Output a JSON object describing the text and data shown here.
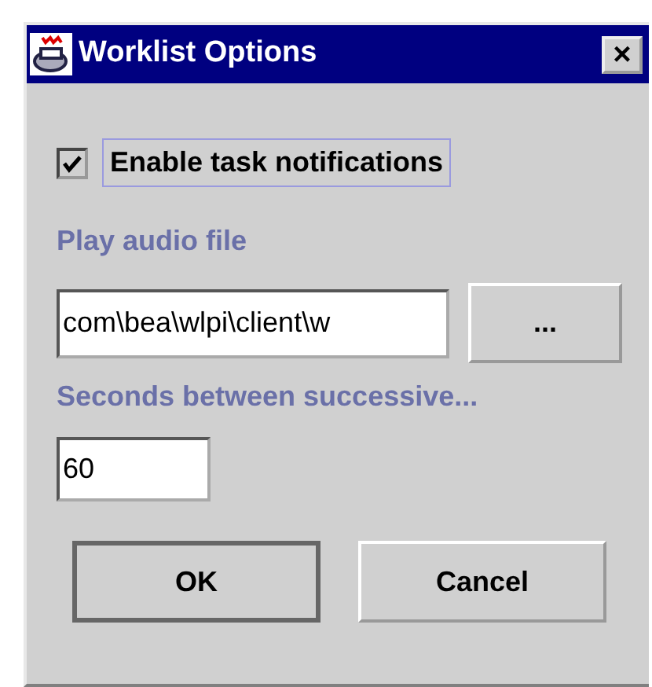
{
  "window": {
    "title": "Worklist Options",
    "close": "×"
  },
  "notifications": {
    "label": "Enable task notifications",
    "checked": true,
    "focused": true
  },
  "audio": {
    "label": "Play audio file",
    "value": "com\\bea\\wlpi\\client\\w",
    "browse": "..."
  },
  "interval": {
    "label": "Seconds between successive...",
    "value": "60"
  },
  "buttons": [
    {
      "label": "OK",
      "default": true
    },
    {
      "label": "Cancel",
      "default": false
    }
  ]
}
